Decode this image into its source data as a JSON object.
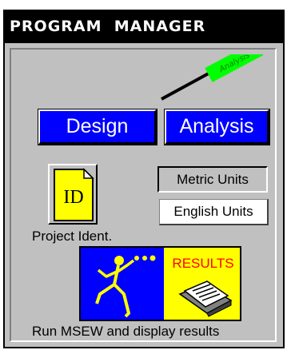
{
  "window": {
    "title": "PROGRAM  MANAGER"
  },
  "analysis_tag": {
    "label": "Analysis",
    "color": "#00ff00"
  },
  "buttons": {
    "design_label": "Design",
    "analysis_label": "Analysis",
    "project_ident_icon_text": "ID",
    "project_ident_label": "Project Ident.",
    "metric_units_label": "Metric Units",
    "english_units_label": "English Units",
    "results_label": "RESULTS",
    "run_label": "Run MSEW and display results"
  },
  "units": {
    "selected": "Metric Units"
  },
  "colors": {
    "button_blue": "#0000ff",
    "results_yellow": "#ffff00",
    "results_red": "#ff0000",
    "window_gray": "#c0c0c0",
    "title_bg": "#000000"
  }
}
